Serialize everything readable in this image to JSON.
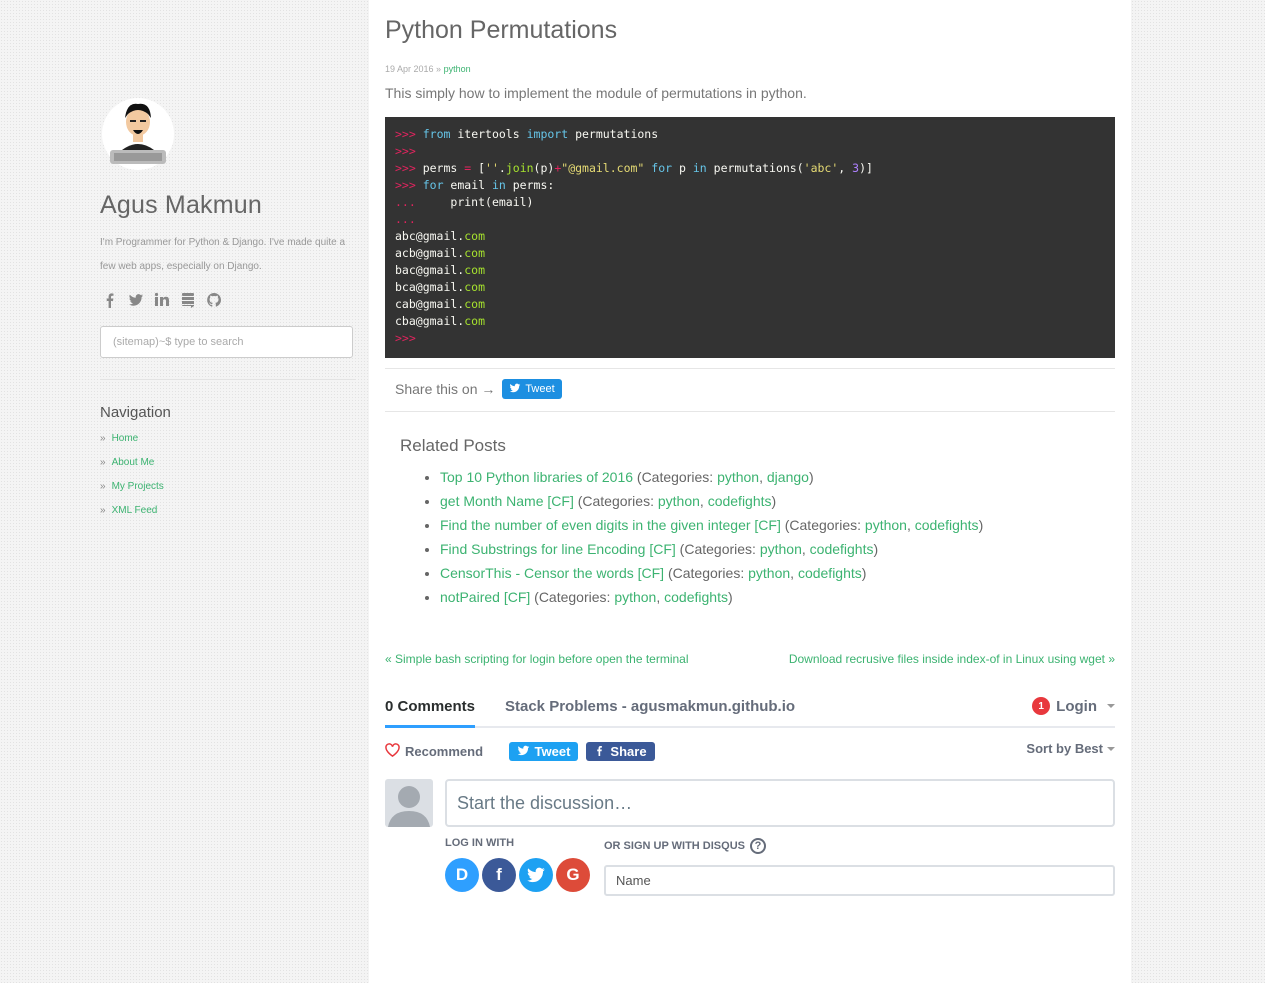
{
  "sidebar": {
    "author": "Agus Makmun",
    "bio": "I'm Programmer for Python & Django. I've made quite a few web apps, especially on Django.",
    "social": [
      "facebook-icon",
      "twitter-icon",
      "linkedin-icon",
      "stackexchange-icon",
      "github-icon"
    ],
    "search_placeholder": "(sitemap)~$ type to search",
    "nav_title": "Navigation",
    "nav": [
      {
        "label": "Home"
      },
      {
        "label": "About Me"
      },
      {
        "label": "My Projects"
      },
      {
        "label": "XML Feed"
      }
    ],
    "bullet": "»"
  },
  "post": {
    "title": "Python Permutations",
    "date": "19 Apr 2016",
    "sep": " » ",
    "category": "python",
    "intro": "This simply how to implement the module of permutations in python.",
    "code_lines": [
      ">>> from itertools import permutations",
      ">>>",
      ">>> perms = [''.join(p)+\"@gmail.com\" for p in permutations('abc', 3)]",
      ">>> for email in perms:",
      "...     print(email)",
      "...",
      "abc@gmail.com",
      "acb@gmail.com",
      "bac@gmail.com",
      "bca@gmail.com",
      "cab@gmail.com",
      "cba@gmail.com",
      ">>>"
    ],
    "share_text": "Share this on →",
    "tweet_label": "Tweet"
  },
  "related": {
    "title": "Related Posts",
    "categories_prefix": "(Categories: ",
    "items": [
      {
        "title": "Top 10 Python libraries of 2016",
        "cats": [
          "python",
          "django"
        ]
      },
      {
        "title": "get Month Name [CF]",
        "cats": [
          "python",
          "codefights"
        ]
      },
      {
        "title": "Find the number of even digits in the given integer [CF]",
        "cats": [
          "python",
          "codefights"
        ]
      },
      {
        "title": "Find Substrings for line Encoding [CF]",
        "cats": [
          "python",
          "codefights"
        ]
      },
      {
        "title": "CensorThis - Censor the words [CF]",
        "cats": [
          "python",
          "codefights"
        ]
      },
      {
        "title": "notPaired [CF]",
        "cats": [
          "python",
          "codefights"
        ]
      }
    ]
  },
  "pager": {
    "prev": "« Simple bash scripting for login before open the terminal",
    "next": "Download recrusive files inside index-of in Linux using wget »"
  },
  "disqus": {
    "comments_tab": "0 Comments",
    "forum": "Stack Problems - agusmakmun.github.io",
    "notif_count": "1",
    "login": "Login",
    "recommend": "Recommend",
    "tweet": "Tweet",
    "share": "Share",
    "sort": "Sort by Best",
    "composer_placeholder": "Start the discussion…",
    "log_in_with": "LOG IN WITH",
    "or_signup": "OR SIGN UP WITH DISQUS",
    "help": "?",
    "name_placeholder": "Name",
    "providers": [
      {
        "name": "disqus",
        "glyph": "D",
        "color": "#2e9fff"
      },
      {
        "name": "facebook",
        "glyph": "f",
        "color": "#3b5998"
      },
      {
        "name": "twitter",
        "glyph": "",
        "color": "#1da1f2"
      },
      {
        "name": "google",
        "glyph": "G",
        "color": "#dd4b39"
      }
    ],
    "accent": "#2e9fff",
    "tweet_color": "#1da1f2",
    "share_color": "#3b5998"
  },
  "colors": {
    "link": "#3cb371",
    "code_bg": "#333333"
  }
}
